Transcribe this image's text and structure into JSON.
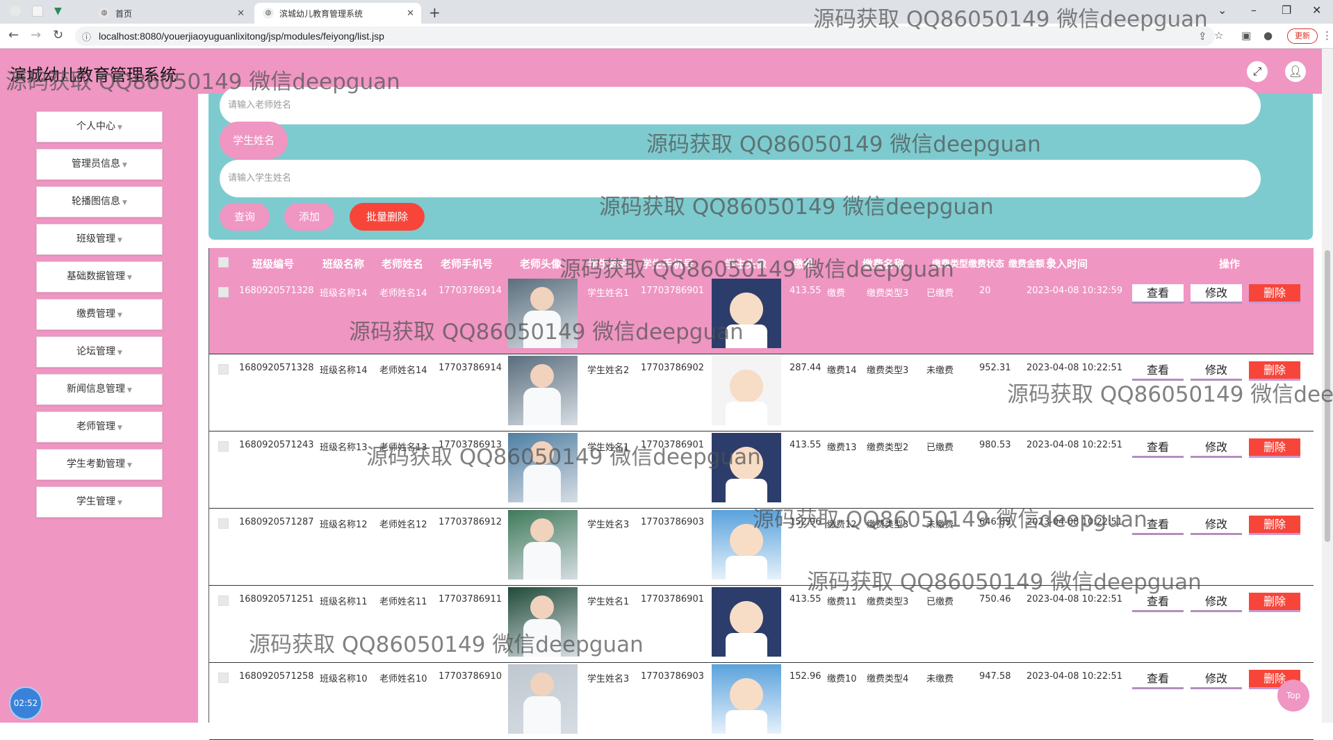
{
  "browser": {
    "tabs": [
      {
        "label": "首页"
      },
      {
        "label": "滨城幼儿教育管理系统"
      }
    ],
    "url": "localhost:8080/youerjiaoyuguanlixitong/jsp/modules/feiyong/list.jsp",
    "update_label": "更新"
  },
  "app": {
    "title": "滨城幼儿教育管理系统"
  },
  "sidebar": {
    "items": [
      {
        "label": "个人中心"
      },
      {
        "label": "管理员信息"
      },
      {
        "label": "轮播图信息"
      },
      {
        "label": "班级管理"
      },
      {
        "label": "基础数据管理"
      },
      {
        "label": "缴费管理"
      },
      {
        "label": "论坛管理"
      },
      {
        "label": "新闻信息管理"
      },
      {
        "label": "老师管理"
      },
      {
        "label": "学生考勤管理"
      },
      {
        "label": "学生管理"
      }
    ]
  },
  "search": {
    "teacher_placeholder": "请输入老师姓名",
    "student_label": "学生姓名",
    "student_placeholder": "请输入学生姓名",
    "query_label": "查询",
    "add_label": "添加",
    "batch_delete_label": "批量删除"
  },
  "table": {
    "headers": [
      "班级编号",
      "班级名称",
      "老师姓名",
      "老师手机号",
      "老师头像",
      "学生姓名",
      "学生手机号",
      "学生头像",
      "缴费",
      "缴费名称",
      "缴费类型",
      "缴费状态",
      "缴费金额",
      "录入时间",
      "操作"
    ],
    "actions": {
      "view": "查看",
      "edit": "修改",
      "delete": "删除"
    },
    "rows": [
      {
        "class_no": "1680920571328",
        "class_name": "班级名称14",
        "teacher": "老师姓名14",
        "teacher_phone": "17703786914",
        "student": "学生姓名1",
        "student_phone": "17703786901",
        "fee": "413.55",
        "fee_name": "缴费",
        "fee_type": "缴费类型3",
        "status": "已缴费",
        "amount": "20",
        "time": "2023-04-08 10:32:59"
      },
      {
        "class_no": "1680920571328",
        "class_name": "班级名称14",
        "teacher": "老师姓名14",
        "teacher_phone": "17703786914",
        "student": "学生姓名2",
        "student_phone": "17703786902",
        "fee": "287.44",
        "fee_name": "缴费14",
        "fee_type": "缴费类型3",
        "status": "未缴费",
        "amount": "952.31",
        "time": "2023-04-08 10:22:51"
      },
      {
        "class_no": "1680920571243",
        "class_name": "班级名称13",
        "teacher": "老师姓名13",
        "teacher_phone": "17703786913",
        "student": "学生姓名1",
        "student_phone": "17703786901",
        "fee": "413.55",
        "fee_name": "缴费13",
        "fee_type": "缴费类型2",
        "status": "已缴费",
        "amount": "980.53",
        "time": "2023-04-08 10:22:51"
      },
      {
        "class_no": "1680920571287",
        "class_name": "班级名称12",
        "teacher": "老师姓名12",
        "teacher_phone": "17703786912",
        "student": "学生姓名3",
        "student_phone": "17703786903",
        "fee": "152.96",
        "fee_name": "缴费12",
        "fee_type": "缴费类型3",
        "status": "未缴费",
        "amount": "646.89",
        "time": "2023-04-08 10:22:51"
      },
      {
        "class_no": "1680920571251",
        "class_name": "班级名称11",
        "teacher": "老师姓名11",
        "teacher_phone": "17703786911",
        "student": "学生姓名1",
        "student_phone": "17703786901",
        "fee": "413.55",
        "fee_name": "缴费11",
        "fee_type": "缴费类型3",
        "status": "已缴费",
        "amount": "750.46",
        "time": "2023-04-08 10:22:51"
      },
      {
        "class_no": "1680920571258",
        "class_name": "班级名称10",
        "teacher": "老师姓名10",
        "teacher_phone": "17703786910",
        "student": "学生姓名3",
        "student_phone": "17703786903",
        "fee": "152.96",
        "fee_name": "缴费10",
        "fee_type": "缴费类型4",
        "status": "未缴费",
        "amount": "947.58",
        "time": "2023-04-08 10:22:51"
      }
    ]
  },
  "clock": "02:52",
  "top_label": "Top",
  "watermark": "源码获取 QQ86050149 微信deepguan",
  "colors": {
    "primary": "#ef96c3",
    "panel": "#7ecbcf",
    "danger": "#f7453a"
  }
}
